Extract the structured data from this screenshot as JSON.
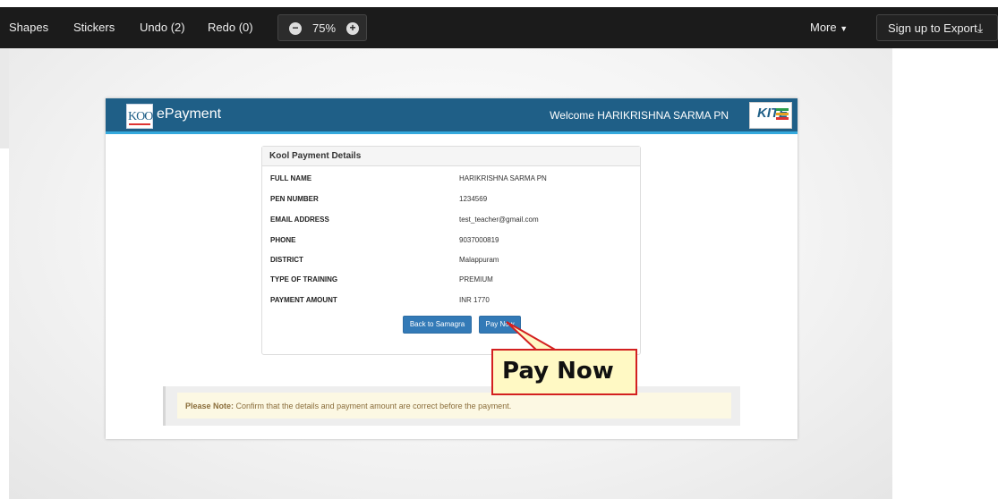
{
  "toolbar": {
    "shapes": "Shapes",
    "stickers": "Stickers",
    "undo": "Undo (2)",
    "redo": "Redo (0)",
    "zoom": "75%",
    "more": "More",
    "export": "Sign up to Export"
  },
  "header": {
    "logo_text": "KOOL",
    "brand": "ePayment",
    "welcome": "Welcome HARIKRISHNA SARMA PN",
    "right_logo_text": "KITE"
  },
  "panel": {
    "title": "Kool Payment Details",
    "rows": [
      {
        "label": "FULL NAME",
        "value": "HARIKRISHNA SARMA PN"
      },
      {
        "label": "PEN NUMBER",
        "value": "1234569"
      },
      {
        "label": "EMAIL ADDRESS",
        "value": "test_teacher@gmail.com"
      },
      {
        "label": "PHONE",
        "value": "9037000819"
      },
      {
        "label": "DISTRICT",
        "value": "Malappuram"
      },
      {
        "label": "TYPE OF TRAINING",
        "value": "PREMIUM"
      },
      {
        "label": "PAYMENT AMOUNT",
        "value": "INR 1770"
      }
    ],
    "back_button": "Back to Samagra",
    "pay_button": "Pay Now"
  },
  "note": {
    "label": "Please Note:",
    "text": " Confirm that the details and payment amount are correct before the payment."
  },
  "callout": {
    "text": "Pay Now"
  },
  "colors": {
    "header": "#1f5f87",
    "header_border": "#35a9dd",
    "button": "#337ab7",
    "callout_border": "#d32020",
    "callout_fill": "#fff9c4"
  }
}
